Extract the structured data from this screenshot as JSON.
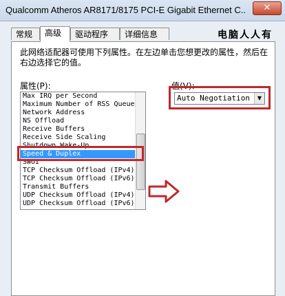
{
  "window": {
    "title": "Qualcomm Atheros AR8171/8175 PCI-E Gigabit Ethernet C...",
    "close_glyph": "✕"
  },
  "tabs": [
    {
      "label": "常规"
    },
    {
      "label": "高级"
    },
    {
      "label": "驱动程序"
    },
    {
      "label": "详细信息"
    }
  ],
  "watermark_top": "电脑人人有",
  "description": "此网络适配器可使用下列属性。在左边单击您想更改的属性，然后在右边选择它的值。",
  "property_label": "属性(P):",
  "value_label": "值(V):",
  "properties": [
    {
      "label": "Max IRQ per Second"
    },
    {
      "label": "Maximum Number of RSS Queue"
    },
    {
      "label": "Network Address"
    },
    {
      "label": "NS Offload"
    },
    {
      "label": "Receive Buffers"
    },
    {
      "label": "Receive Side Scaling"
    },
    {
      "label": "Shutdown Wake-Up"
    },
    {
      "label": "Speed & Duplex"
    },
    {
      "label": "SWOI"
    },
    {
      "label": "TCP Checksum Offload (IPv4)"
    },
    {
      "label": "TCP Checksum Offload (IPv6)"
    },
    {
      "label": "Transmit Buffers"
    },
    {
      "label": "UDP Checksum Offload (IPv4)"
    },
    {
      "label": "UDP Checksum Offload (IPv6)"
    }
  ],
  "selected_property": "Speed & Duplex",
  "value_select": {
    "selected": "Auto Negotiation"
  },
  "annotation_color": "#c0272d",
  "selection_color": "#3399ff"
}
